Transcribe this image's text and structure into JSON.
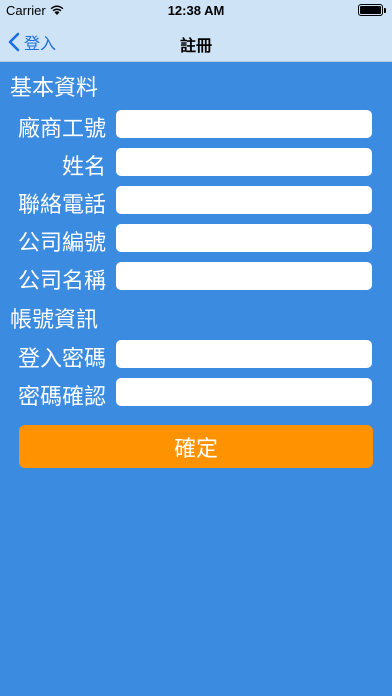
{
  "status_bar": {
    "carrier": "Carrier",
    "time": "12:38 AM",
    "battery_level": 1.0
  },
  "nav": {
    "back_label": "登入",
    "title": "註冊"
  },
  "sections": {
    "basic_info": "基本資料",
    "account_info": "帳號資訊"
  },
  "fields": [
    {
      "label": "廠商工號",
      "value": ""
    },
    {
      "label": "姓名",
      "value": ""
    },
    {
      "label": "聯絡電話",
      "value": ""
    },
    {
      "label": "公司編號",
      "value": ""
    },
    {
      "label": "公司名稱",
      "value": ""
    },
    {
      "label": "登入密碼",
      "value": ""
    },
    {
      "label": "密碼確認",
      "value": ""
    }
  ],
  "confirm_label": "確定",
  "colors": {
    "background": "#3b8be0",
    "nav_bar": "#cfe3f7",
    "accent": "#1a6fe0",
    "button": "#ff9200"
  }
}
